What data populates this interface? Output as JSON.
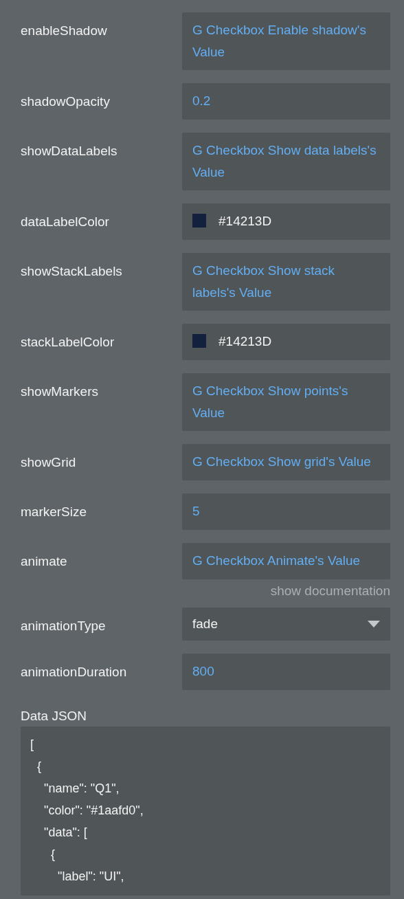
{
  "properties": [
    {
      "label": "enableShadow",
      "kind": "dynamic",
      "value": "G Checkbox Enable shadow's Value"
    },
    {
      "label": "shadowOpacity",
      "kind": "dynamic",
      "value": "0.2"
    },
    {
      "label": "showDataLabels",
      "kind": "dynamic",
      "value": "G Checkbox Show data labels's Value"
    },
    {
      "label": "dataLabelColor",
      "kind": "color",
      "value": "#14213D",
      "color": "#14213d"
    },
    {
      "label": "showStackLabels",
      "kind": "dynamic",
      "value": "G Checkbox Show stack labels's Value"
    },
    {
      "label": "stackLabelColor",
      "kind": "color",
      "value": "#14213D",
      "color": "#14213d"
    },
    {
      "label": "showMarkers",
      "kind": "dynamic",
      "value": "G Checkbox Show points's Value"
    },
    {
      "label": "showGrid",
      "kind": "dynamic",
      "value": "G Checkbox Show grid's Value"
    },
    {
      "label": "markerSize",
      "kind": "dynamic",
      "value": "5"
    },
    {
      "label": "animate",
      "kind": "dynamic",
      "value": "G Checkbox Animate's Value",
      "doc_link": "show documentation"
    },
    {
      "label": "animationType",
      "kind": "dropdown",
      "value": "fade"
    },
    {
      "label": "animationDuration",
      "kind": "dynamic",
      "value": "800"
    }
  ],
  "data_json": {
    "label": "Data JSON",
    "lines": [
      "[",
      "  {",
      "    \"name\": \"Q1\",",
      "    \"color\": \"#1aafd0\",",
      "    \"data\": [",
      "      {",
      "        \"label\": \"UI\","
    ]
  }
}
